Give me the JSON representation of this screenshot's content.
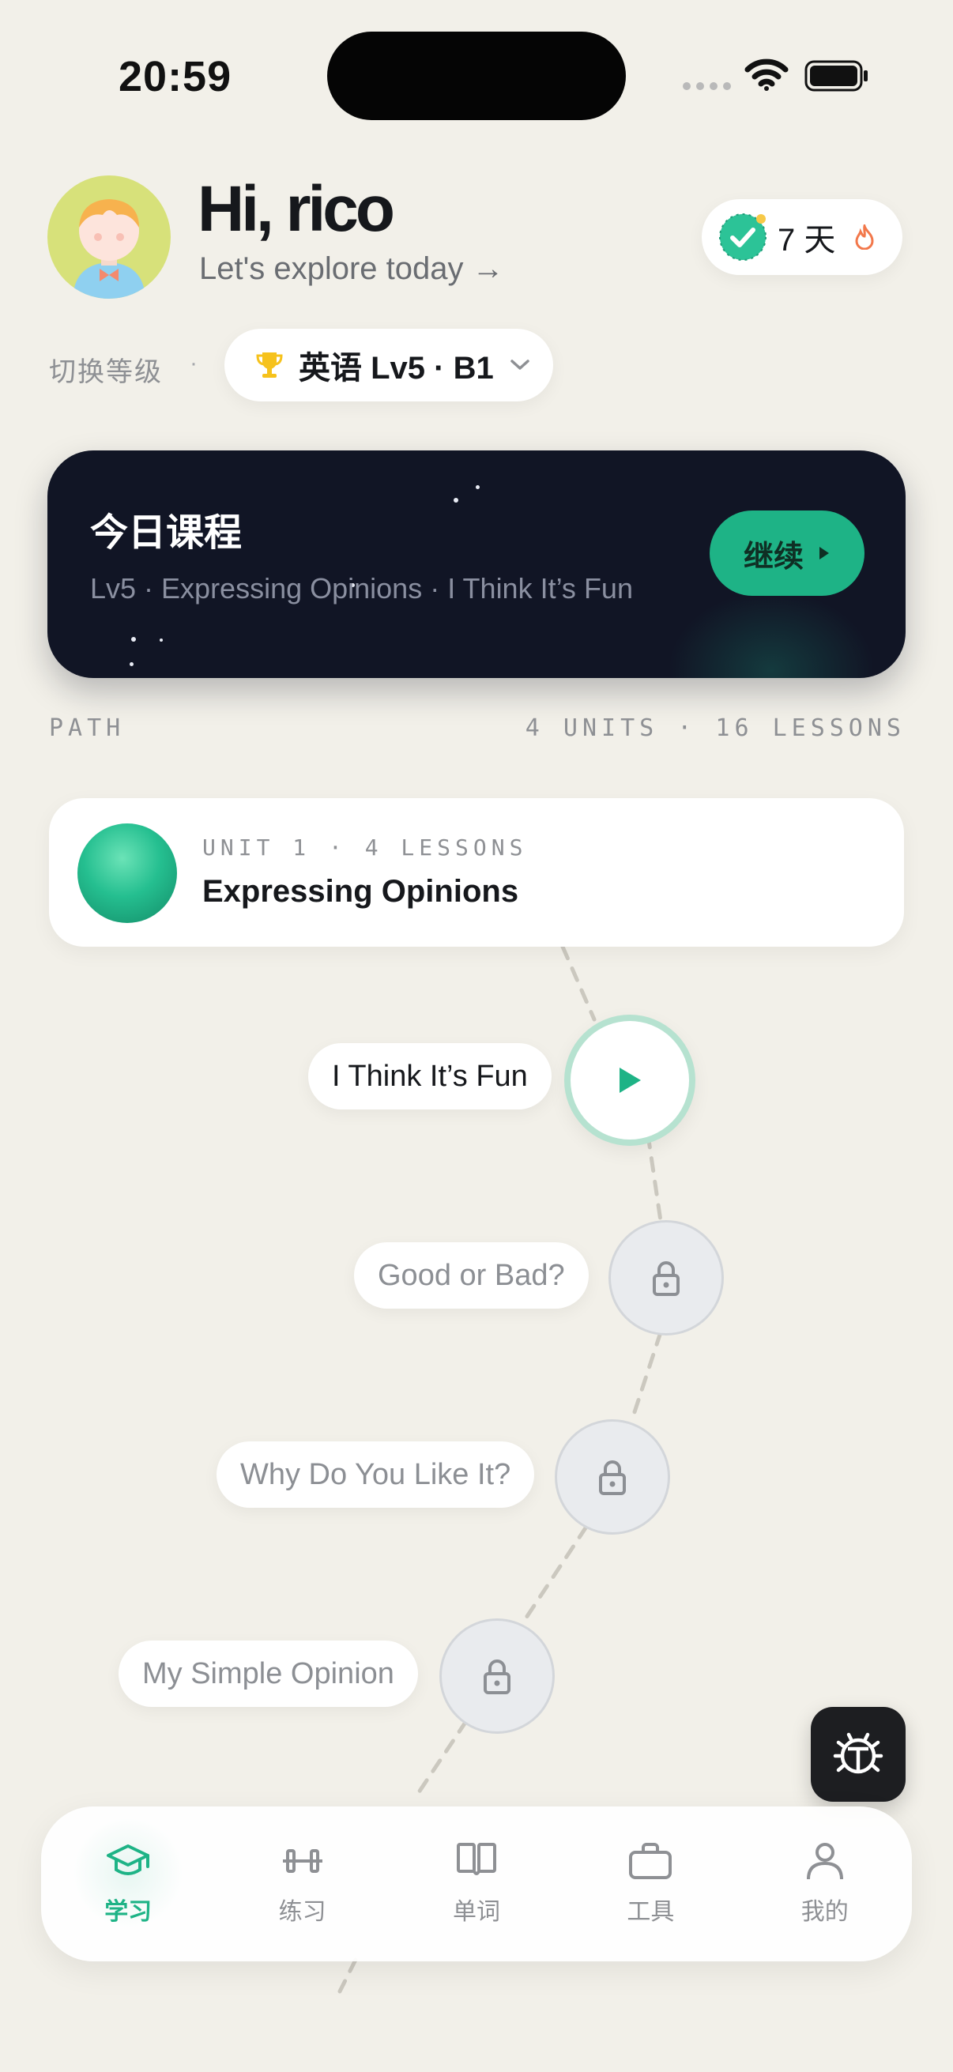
{
  "status_bar": {
    "time": "20:59"
  },
  "header": {
    "greeting": "Hi, rico",
    "subtitle": "Let's explore today →",
    "streak": {
      "value": "7 天"
    }
  },
  "level": {
    "label": "切换等级",
    "separator": "·",
    "current": "英语 Lv5 · B1"
  },
  "today_course": {
    "title": "今日课程",
    "subtitle": "Lv5 · Expressing Opinions · I Think It’s Fun",
    "button_label": "继续"
  },
  "path": {
    "label": "PATH",
    "meta": "4 UNITS · 16 LESSONS"
  },
  "unit": {
    "meta": "UNIT 1 · 4 LESSONS",
    "title": "Expressing Opinions"
  },
  "lessons": [
    {
      "title": "I Think It’s Fun",
      "state": "active"
    },
    {
      "title": "Good or Bad?",
      "state": "locked"
    },
    {
      "title": "Why Do You Like It?",
      "state": "locked"
    },
    {
      "title": "My Simple Opinion",
      "state": "locked"
    }
  ],
  "tabs": [
    {
      "label": "学习",
      "icon": "graduation-cap-icon",
      "active": true
    },
    {
      "label": "练习",
      "icon": "dumbbell-icon",
      "active": false
    },
    {
      "label": "单词",
      "icon": "book-icon",
      "active": false
    },
    {
      "label": "工具",
      "icon": "briefcase-icon",
      "active": false
    },
    {
      "label": "我的",
      "icon": "user-icon",
      "active": false
    }
  ],
  "colors": {
    "accent": "#1eb386",
    "background": "#f2f0e9",
    "hero_card": "#111525"
  }
}
